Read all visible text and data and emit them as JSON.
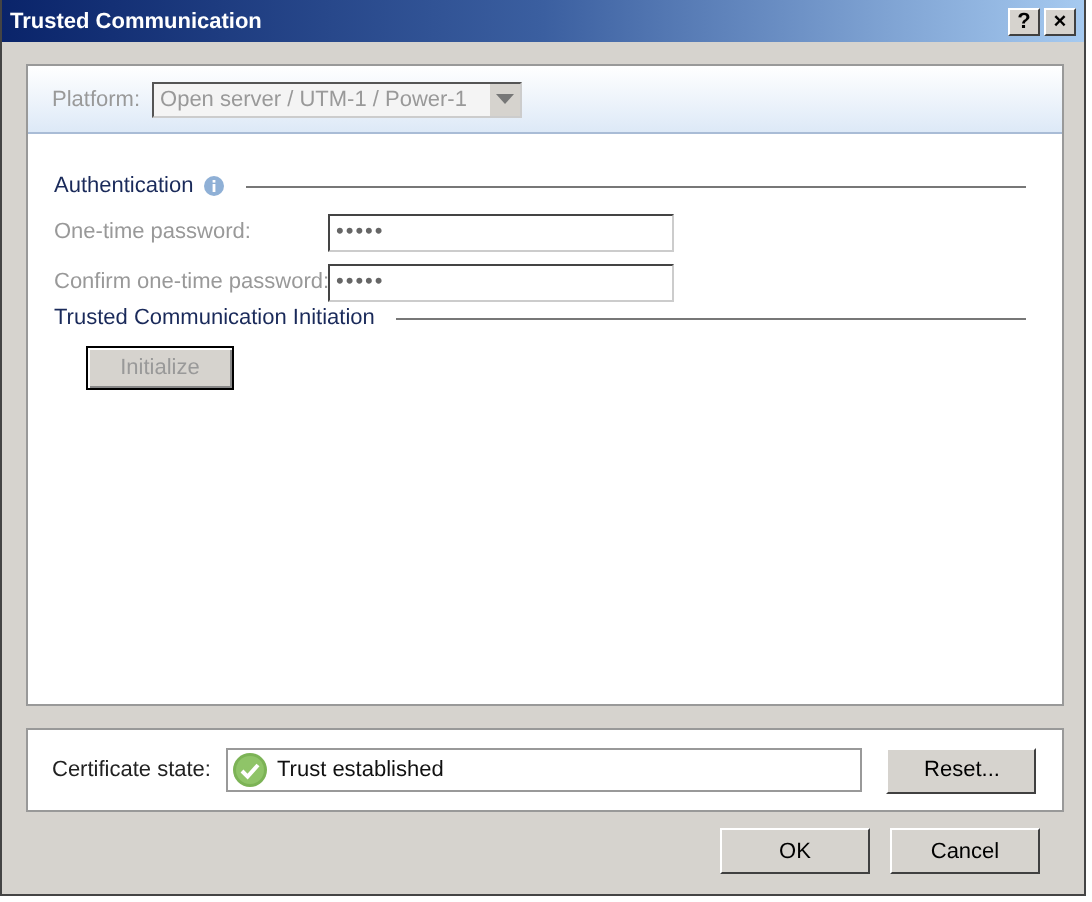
{
  "window": {
    "title": "Trusted Communication",
    "buttons": [
      "?",
      "×"
    ]
  },
  "platform": {
    "label": "Platform:",
    "value": "Open server / UTM-1 / Power-1",
    "disabled": true
  },
  "authentication": {
    "title": "Authentication",
    "fields": [
      {
        "label": "One-time password:",
        "value": "•••••",
        "disabled": true
      },
      {
        "label": "Confirm one-time password:",
        "value": "•••••",
        "disabled": true
      }
    ]
  },
  "initiation": {
    "title": "Trusted Communication Initiation",
    "button": {
      "label": "Initialize",
      "disabled": true
    }
  },
  "certificate": {
    "label": "Certificate state:",
    "value": "Trust established",
    "kind": "ok",
    "button": "Reset..."
  },
  "buttons": [
    "OK",
    "Cancel"
  ]
}
